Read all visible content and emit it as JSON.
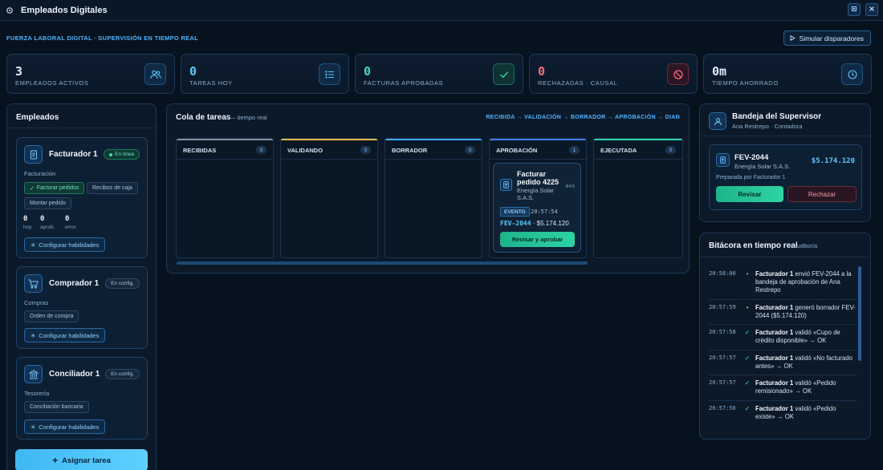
{
  "window": {
    "title": "Empleados Digitales"
  },
  "subheader": "FUERZA LABORAL DIGITAL · SUPERVISIÓN EN TIEMPO REAL",
  "simulate_label": "Simular disparadores",
  "stats": [
    {
      "value": "3",
      "label": "EMPLEADOS ACTIVOS",
      "color": "#dfeeff",
      "icon": "users-icon"
    },
    {
      "value": "0",
      "label": "TAREAS HOY",
      "color": "#5cc8ff",
      "icon": "list-icon"
    },
    {
      "value": "0",
      "label": "FACTURAS APROBADAS",
      "color": "#3fe0b0",
      "icon": "check-icon"
    },
    {
      "value": "0",
      "label": "RECHAZADAS · CAUSAL",
      "color": "#ff6b7d",
      "icon": "ban-icon"
    },
    {
      "value": "0m",
      "label": "TIEMPO AHORRADO",
      "color": "#dfeeff",
      "icon": "clock-icon"
    }
  ],
  "employees_panel": {
    "title": "Empleados",
    "assign_label": "Asignar tarea",
    "employees": [
      {
        "name": "Facturador 1",
        "status": "En línea",
        "dept": "Facturación",
        "skills": [
          "Facturar pedidos",
          "Recibos de caja",
          "Montar pedido"
        ],
        "counters": [
          {
            "n": "0",
            "t": "hoy"
          },
          {
            "n": "0",
            "t": "aprob."
          },
          {
            "n": "0",
            "t": "error"
          }
        ],
        "config_label": "Configurar habilidades",
        "icon": "invoice-icon"
      },
      {
        "name": "Comprador 1",
        "status": "En config.",
        "dept": "Compras",
        "skills": [
          "Orden de compra"
        ],
        "config_label": "Configurar habilidades",
        "icon": "cart-icon"
      },
      {
        "name": "Conciliador 1",
        "status": "En config.",
        "dept": "Tesorería",
        "skills": [
          "Conciliación bancaria"
        ],
        "config_label": "Configurar habilidades",
        "icon": "bank-icon"
      }
    ]
  },
  "queue": {
    "title": "Cola de tareas",
    "subtitle": "— tiempo real",
    "flow": "RECIBIDA → VALIDACIÓN → BORRADOR → APROBACIÓN → DIAN",
    "columns": [
      {
        "name": "RECIBIDAS",
        "count": "0",
        "color": "#7e8fa3"
      },
      {
        "name": "VALIDANDO",
        "count": "0",
        "color": "#e6b84a"
      },
      {
        "name": "BORRADOR",
        "count": "0",
        "color": "#3fa9f5"
      },
      {
        "name": "APROBACIÓN",
        "count": "1",
        "color": "#3f7bf5"
      },
      {
        "name": "EJECUTADA",
        "count": "0",
        "color": "#2fd3a5"
      }
    ],
    "task": {
      "title": "Facturar pedido 4225",
      "client": "Energía Solar S.A.S.",
      "number": "#48",
      "badge": "EVENTO",
      "time": "20:57:54",
      "invoice": "FEV-2044",
      "amount": " · $5.174.120",
      "action": "Revisar y aprobar"
    }
  },
  "supervisor": {
    "title": "Bandeja del Supervisor",
    "person": "Ana Restrepo · Contadora",
    "invoice": "FEV-2044",
    "client": "Energía Solar S.A.S.",
    "amount": "$5.174.120",
    "prepared": "Preparada por Facturador 1",
    "review_label": "Revisar",
    "reject_label": "Rechazar"
  },
  "log": {
    "title": "Bitácora en tiempo real",
    "subtitle": "auditoría",
    "entries": [
      {
        "time": "20:58:00",
        "icon": "•",
        "color": "#4fb3ff",
        "actor": "Facturador 1",
        "text": " envió FEV-2044 a la bandeja de aprobación de Ana Restrepo"
      },
      {
        "time": "20:57:59",
        "icon": "•",
        "color": "#e6b84a",
        "actor": "Facturador 1",
        "text": " generó borrador FEV-2044 ($5.174.120)"
      },
      {
        "time": "20:57:58",
        "icon": "✓",
        "color": "#3fe0b0",
        "actor": "Facturador 1",
        "text": " validó «Cupo de crédito disponible» → OK"
      },
      {
        "time": "20:57:57",
        "icon": "✓",
        "color": "#3fe0b0",
        "actor": "Facturador 1",
        "text": " validó «No facturado antes» → OK"
      },
      {
        "time": "20:57:57",
        "icon": "✓",
        "color": "#3fe0b0",
        "actor": "Facturador 1",
        "text": " validó «Pedido remisionado» → OK"
      },
      {
        "time": "20:57:56",
        "icon": "✓",
        "color": "#3fe0b0",
        "actor": "Facturador 1",
        "text": " validó «Pedido existe» → OK"
      }
    ]
  }
}
